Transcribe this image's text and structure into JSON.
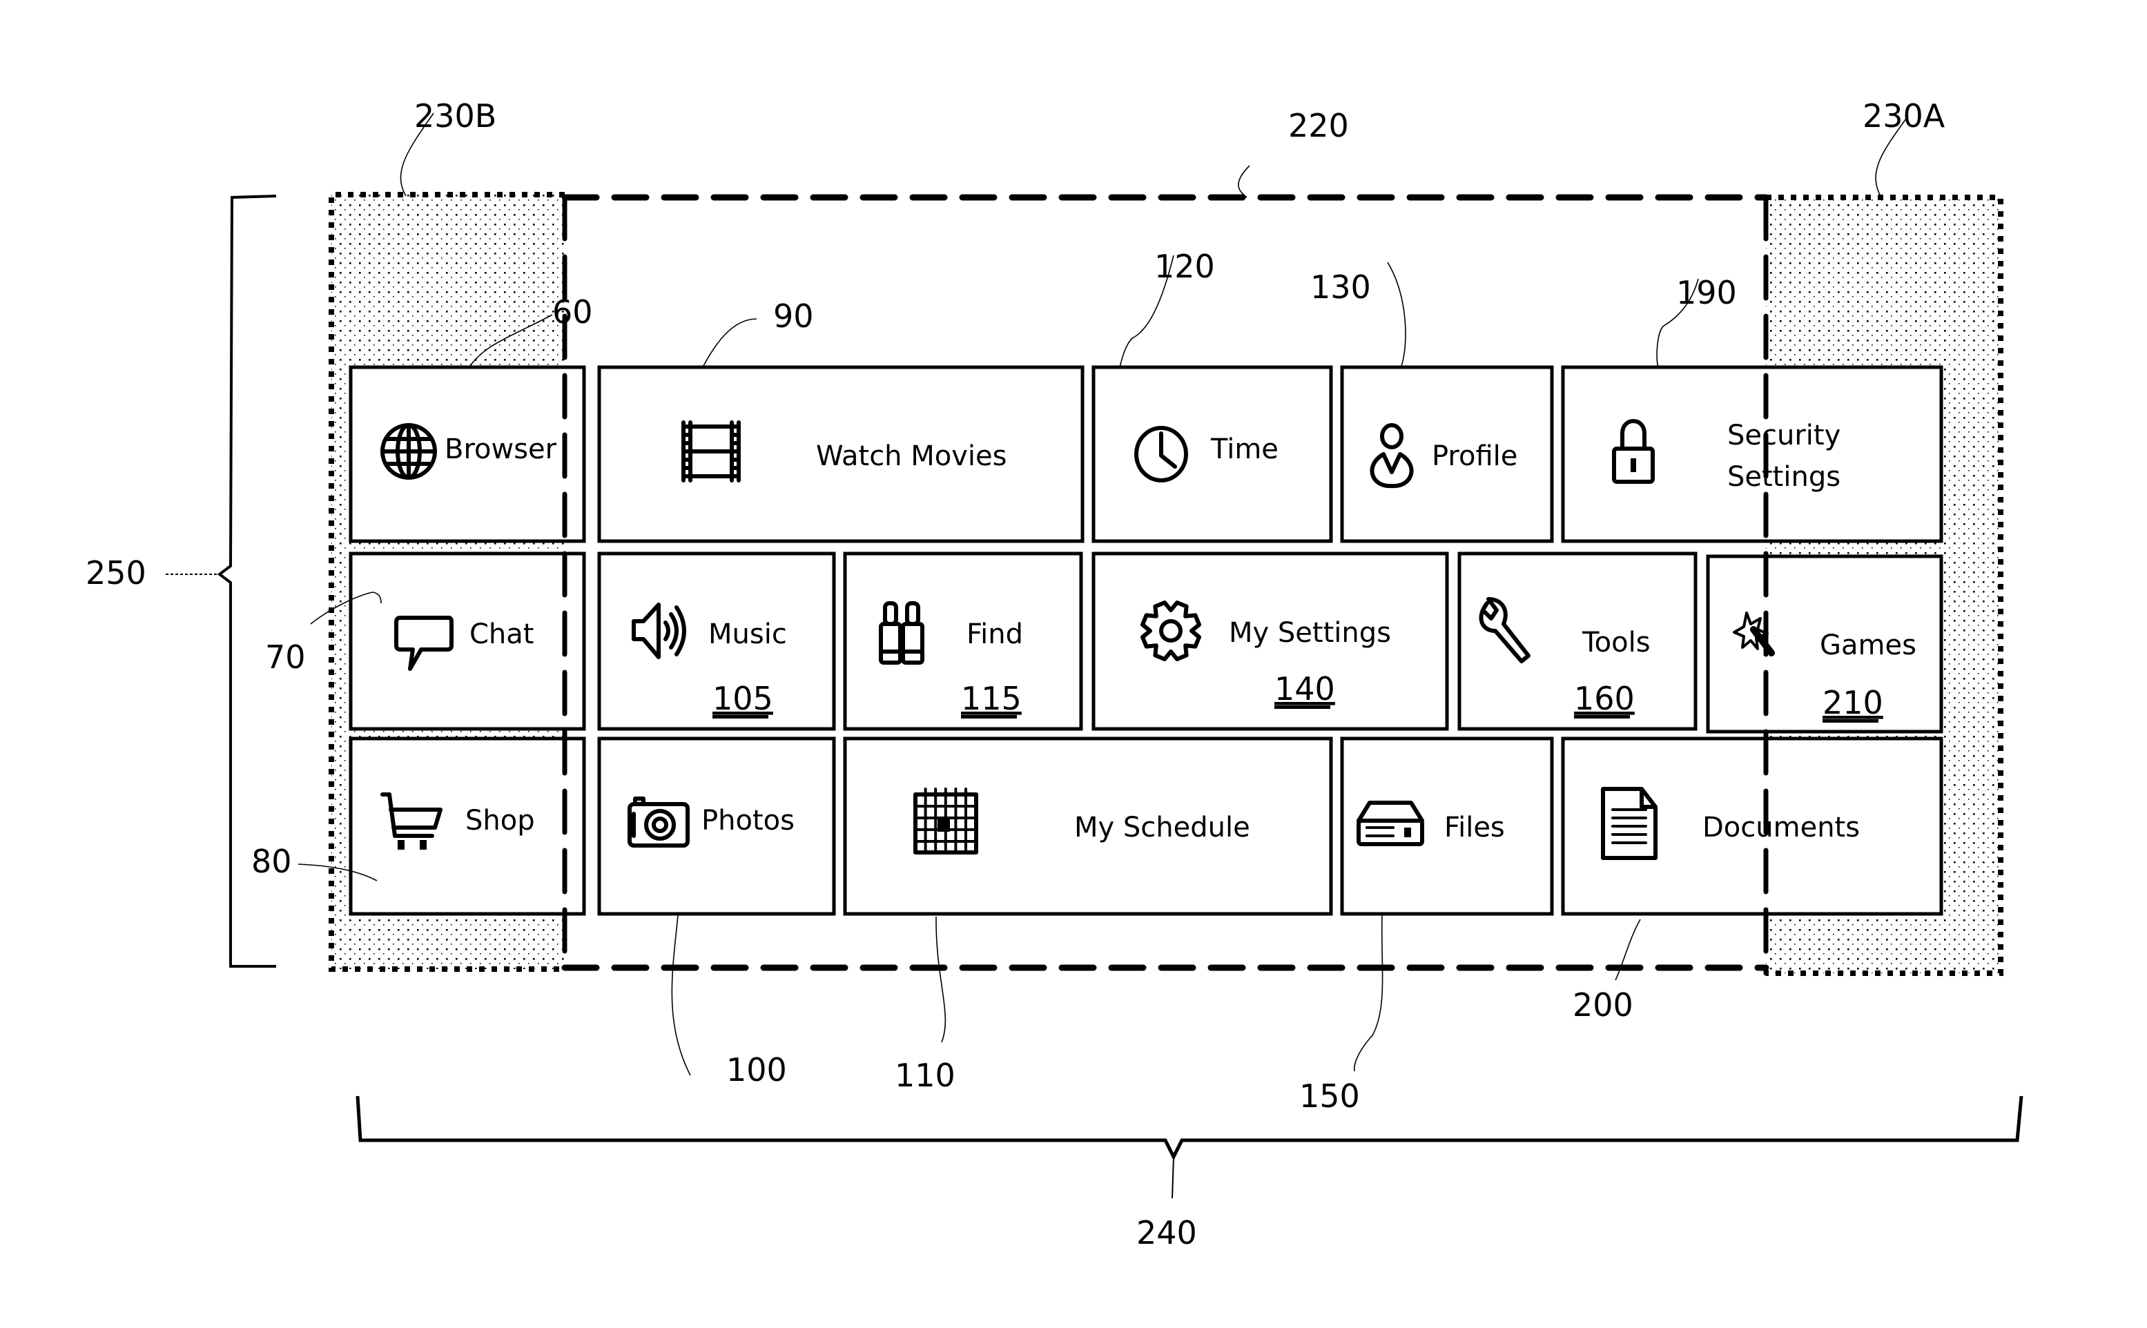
{
  "figure": {
    "regions": [
      {
        "id": "region-230B",
        "ref": "230B",
        "kind": "dotted-shaded-side-region"
      },
      {
        "id": "region-220",
        "ref": "220",
        "kind": "dashed-visible-region"
      },
      {
        "id": "region-230A",
        "ref": "230A",
        "kind": "dotted-shaded-side-region"
      }
    ],
    "braces": [
      {
        "id": "brace-250",
        "ref": "250",
        "orientation": "vertical"
      },
      {
        "id": "brace-240",
        "ref": "240",
        "orientation": "horizontal"
      }
    ],
    "tiles": [
      {
        "key": "browser",
        "label": "Browser",
        "icon": "globe-icon",
        "ref": "60",
        "number": ""
      },
      {
        "key": "watch-movies",
        "label": "Watch Movies",
        "icon": "film-icon",
        "ref": "90",
        "number": ""
      },
      {
        "key": "time",
        "label": "Time",
        "icon": "clock-icon",
        "ref": "120",
        "number": ""
      },
      {
        "key": "profile",
        "label": "Profile",
        "icon": "user-icon",
        "ref": "130",
        "number": ""
      },
      {
        "key": "security-settings",
        "label": "Security Settings",
        "label_lines": [
          "Security",
          "Settings"
        ],
        "icon": "lock-icon",
        "ref": "190",
        "number": ""
      },
      {
        "key": "chat",
        "label": "Chat",
        "icon": "speech-bubble-icon",
        "ref": "70",
        "number": ""
      },
      {
        "key": "music",
        "label": "Music",
        "icon": "speaker-icon",
        "ref": "",
        "number": "105"
      },
      {
        "key": "find",
        "label": "Find",
        "icon": "binoculars-icon",
        "ref": "",
        "number": "115"
      },
      {
        "key": "my-settings",
        "label": "My Settings",
        "icon": "gear-icon",
        "ref": "",
        "number": "140"
      },
      {
        "key": "tools",
        "label": "Tools",
        "icon": "wrench-icon",
        "ref": "",
        "number": "160"
      },
      {
        "key": "games",
        "label": "Games",
        "icon": "magic-wand-icon",
        "ref": "",
        "number": "210"
      },
      {
        "key": "shop",
        "label": "Shop",
        "icon": "shopping-cart-icon",
        "ref": "80",
        "number": ""
      },
      {
        "key": "photos",
        "label": "Photos",
        "icon": "camera-icon",
        "ref": "100",
        "number": ""
      },
      {
        "key": "my-schedule",
        "label": "My Schedule",
        "icon": "calendar-icon",
        "ref": "110",
        "number": ""
      },
      {
        "key": "files",
        "label": "Files",
        "icon": "drive-icon",
        "ref": "150",
        "number": ""
      },
      {
        "key": "documents",
        "label": "Documents",
        "icon": "document-icon",
        "ref": "200",
        "number": ""
      }
    ],
    "reference_labels": {
      "r230B": "230B",
      "r220": "220",
      "r230A": "230A",
      "r60": "60",
      "r90": "90",
      "r120": "120",
      "r130": "130",
      "r190": "190",
      "r70": "70",
      "r80": "80",
      "r100": "100",
      "r110": "110",
      "r150": "150",
      "r200": "200",
      "r250": "250",
      "r240": "240"
    }
  }
}
